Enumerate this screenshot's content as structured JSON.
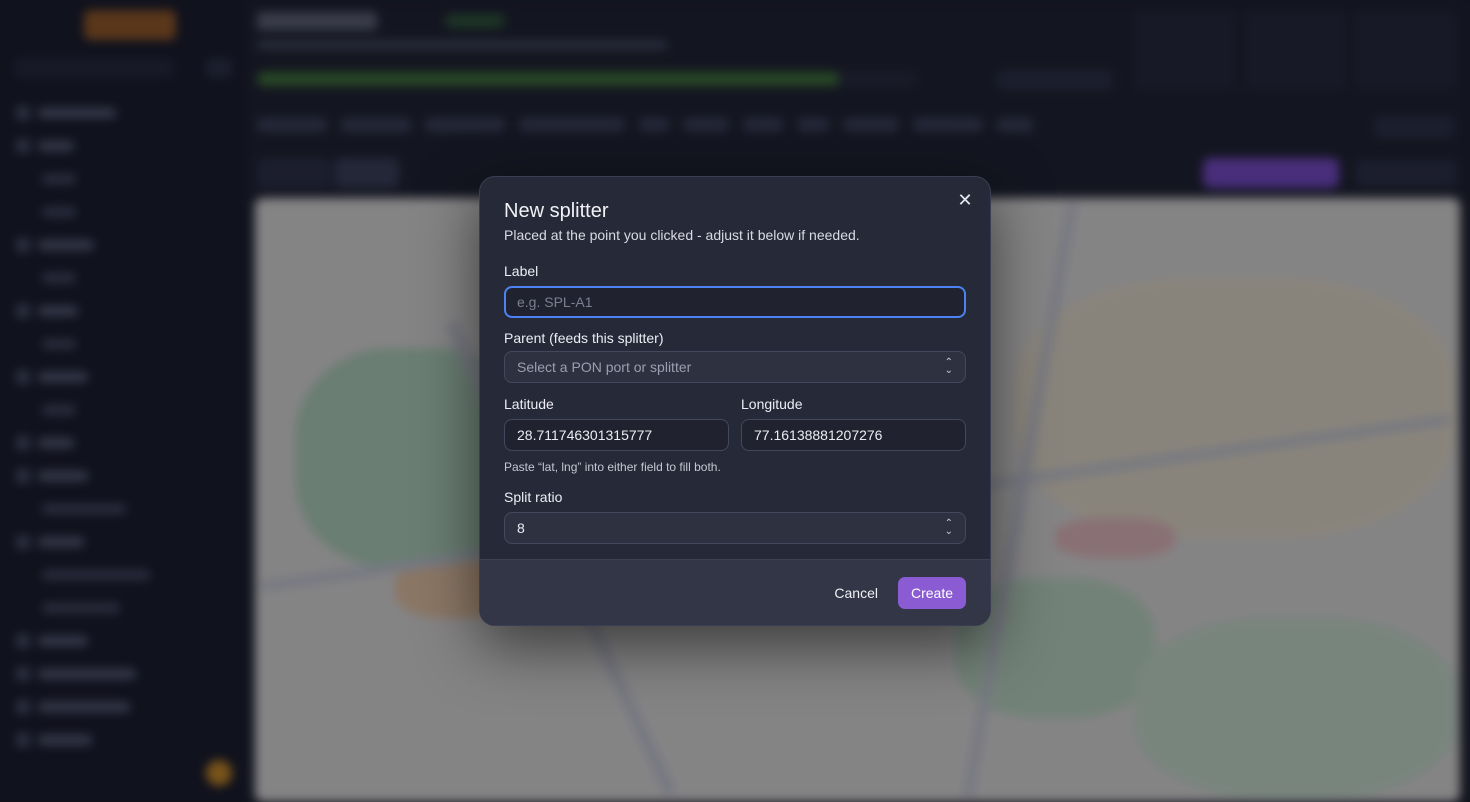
{
  "dialog": {
    "title": "New splitter",
    "description": "Placed at the point you clicked - adjust it below if needed.",
    "close_icon": "close-icon",
    "label_field": {
      "label": "Label",
      "placeholder": "e.g. SPL-A1",
      "value": ""
    },
    "parent_field": {
      "label": "Parent (feeds this splitter)",
      "placeholder": "Select a PON port or splitter"
    },
    "latitude_field": {
      "label": "Latitude",
      "value": "28.711746301315777"
    },
    "longitude_field": {
      "label": "Longitude",
      "value": "77.16138881207276"
    },
    "coords_hint": "Paste “lat, lng” into either field to fill both.",
    "split_ratio_field": {
      "label": "Split ratio",
      "value": "8"
    },
    "cancel_label": "Cancel",
    "create_label": "Create"
  },
  "colors": {
    "accent": "#8a5bd3",
    "focus_ring": "#4c82f2",
    "dialog_bg": "#262938"
  }
}
